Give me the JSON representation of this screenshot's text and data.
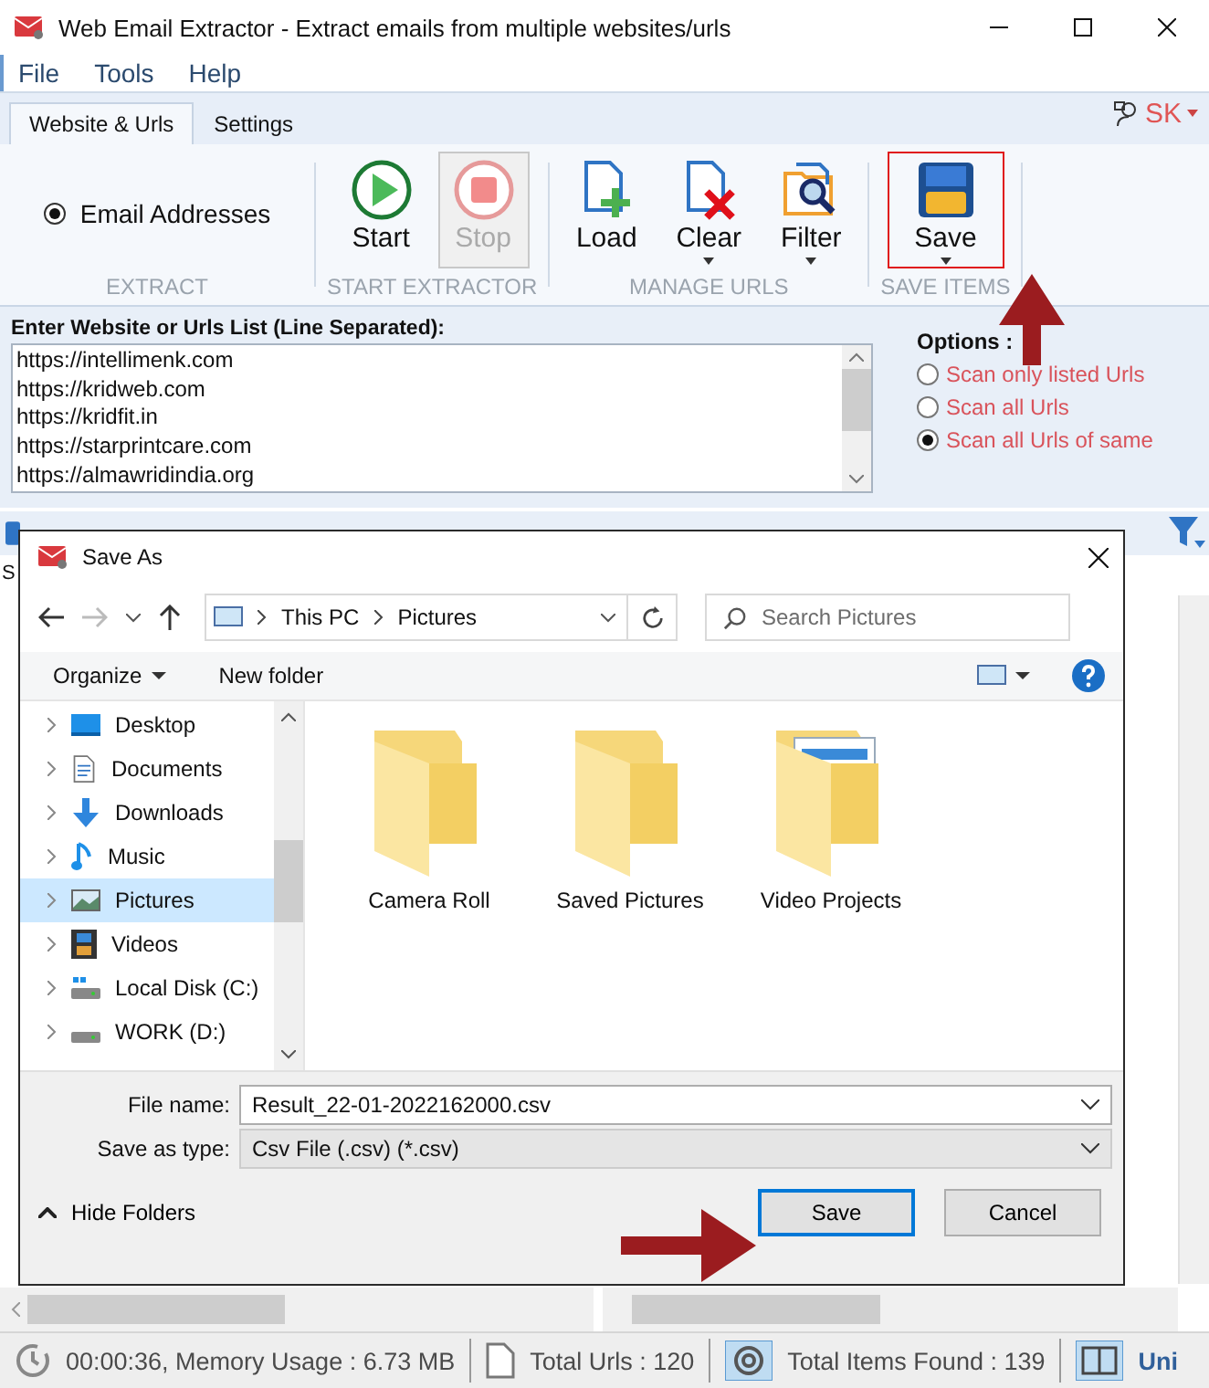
{
  "window": {
    "title": "Web Email Extractor - Extract emails from multiple websites/urls"
  },
  "menu": [
    "File",
    "Tools",
    "Help"
  ],
  "tabs": [
    {
      "label": "Website & Urls",
      "selected": true
    },
    {
      "label": "Settings",
      "selected": false
    }
  ],
  "user": "SK",
  "ribbon": {
    "extract": {
      "label": "EXTRACT",
      "option": {
        "label": "Email Addresses",
        "selected": true
      }
    },
    "groups": [
      {
        "label": "START EXTRACTOR",
        "buttons": [
          {
            "label": "Start",
            "disabled": false,
            "dropdown": false,
            "highlighted": false
          },
          {
            "label": "Stop",
            "disabled": true,
            "dropdown": false,
            "highlighted": false
          }
        ]
      },
      {
        "label": "MANAGE URLS",
        "buttons": [
          {
            "label": "Load",
            "disabled": false,
            "dropdown": false,
            "highlighted": false
          },
          {
            "label": "Clear",
            "disabled": false,
            "dropdown": true,
            "highlighted": false
          },
          {
            "label": "Filter",
            "disabled": false,
            "dropdown": true,
            "highlighted": false
          }
        ]
      },
      {
        "label": "SAVE ITEMS",
        "buttons": [
          {
            "label": "Save",
            "disabled": false,
            "dropdown": true,
            "highlighted": true
          }
        ]
      }
    ]
  },
  "urls": {
    "label": "Enter Website or Urls List (Line Separated):",
    "lines": [
      "https://intellimenk.com",
      "https://kridweb.com",
      "https://kridfit.in",
      "https://starprintcare.com",
      "https://almawridindia.org"
    ]
  },
  "options": {
    "label": "Options :",
    "items": [
      {
        "label": "Scan only listed Urls",
        "selected": false
      },
      {
        "label": "Scan all Urls",
        "selected": false
      },
      {
        "label": "Scan all Urls of same",
        "selected": true
      }
    ]
  },
  "results": {
    "column_1": "S"
  },
  "dialog": {
    "title": "Save As",
    "path": [
      "This PC",
      "Pictures"
    ],
    "search": {
      "placeholder": "Search Pictures"
    },
    "toolbar": [
      "Organize",
      "New folder"
    ],
    "nav": [
      {
        "label": "Desktop",
        "selected": false
      },
      {
        "label": "Documents",
        "selected": false
      },
      {
        "label": "Downloads",
        "selected": false
      },
      {
        "label": "Music",
        "selected": false
      },
      {
        "label": "Pictures",
        "selected": true
      },
      {
        "label": "Videos",
        "selected": false
      },
      {
        "label": "Local Disk (C:)",
        "selected": false
      },
      {
        "label": "WORK (D:)",
        "selected": false
      }
    ],
    "folders": [
      "Camera Roll",
      "Saved Pictures",
      "Video Projects"
    ],
    "file_name": {
      "label": "File name:",
      "value": "Result_22-01-2022162000.csv"
    },
    "file_type": {
      "label": "Save as type:",
      "value": "Csv File (.csv) (*.csv)"
    },
    "hide_folders": "Hide Folders",
    "buttons": [
      "Save",
      "Cancel"
    ]
  },
  "status_bar": {
    "time": "00:00:36, Memory Usage : 6.73 MB",
    "urls": "Total Urls : 120",
    "items": "Total Items Found : 139",
    "unique": "Uni"
  }
}
